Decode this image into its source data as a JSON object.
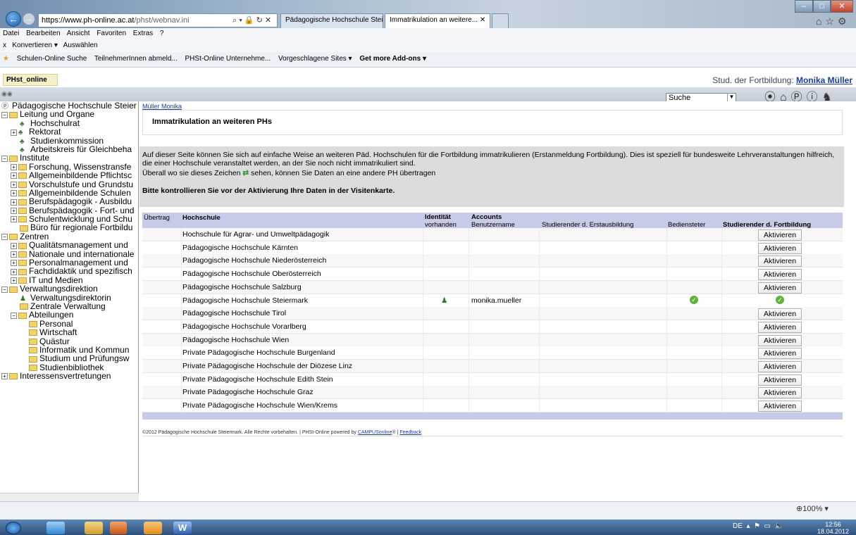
{
  "browser": {
    "address_host": "https://www.ph-online.ac.at",
    "address_path": "/phst/webnav.ini",
    "address_controls": "⌕ ▾ 🔒 ↻ ✕",
    "tab1": "Pädagogische Hochschule Stei...",
    "tab2": "Immatrikulation an weitere...",
    "menu": [
      "Datei",
      "Bearbeiten",
      "Ansicht",
      "Favoriten",
      "Extras",
      "?"
    ],
    "cmd_close": "x",
    "cmd_convert": "Konvertieren",
    "cmd_select": "Auswählen",
    "favorites": [
      "Schulen-Online Suche",
      "TeilnehmerInnen abmeld...",
      "PHSt-Online Unternehme...",
      "Vorgeschlagene Sites ▾",
      "Get more Add-ons ▾"
    ],
    "zoom": "100%"
  },
  "app": {
    "tab_label": "PHst_online",
    "user_prefix": "Stud. der Fortbildung:",
    "user_name": "Monika Müller",
    "search_value": "Suche"
  },
  "sidebar": {
    "items": [
      {
        "label": "Pädagogische Hochschule Steier",
        "indent": 0,
        "kind": "root"
      },
      {
        "label": "Leitung und Organe",
        "indent": 0,
        "kind": "folder",
        "exp": "−"
      },
      {
        "label": "Hochschulrat",
        "indent": 2,
        "kind": "people"
      },
      {
        "label": "Rektorat",
        "indent": 1,
        "kind": "people",
        "exp": "+"
      },
      {
        "label": "Studienkommission",
        "indent": 2,
        "kind": "people"
      },
      {
        "label": "Arbeitskreis für Gleichbeha",
        "indent": 2,
        "kind": "people"
      },
      {
        "label": "Institute",
        "indent": 0,
        "kind": "folder",
        "exp": "−"
      },
      {
        "label": "Forschung, Wissenstransfe",
        "indent": 1,
        "kind": "folder",
        "exp": "+"
      },
      {
        "label": "Allgemeinbildende Pflichtsc",
        "indent": 1,
        "kind": "folder",
        "exp": "+"
      },
      {
        "label": "Vorschulstufe und Grundstu",
        "indent": 1,
        "kind": "folder",
        "exp": "+"
      },
      {
        "label": "Allgemeinbildende Schulen",
        "indent": 1,
        "kind": "folder",
        "exp": "+"
      },
      {
        "label": "Berufspädagogik - Ausbildu",
        "indent": 1,
        "kind": "folder",
        "exp": "+"
      },
      {
        "label": "Berufspädagogik - Fort- und",
        "indent": 1,
        "kind": "folder",
        "exp": "+"
      },
      {
        "label": "Schulentwicklung und Schu",
        "indent": 1,
        "kind": "folder",
        "exp": "+"
      },
      {
        "label": "Büro für regionale Fortbildu",
        "indent": 2,
        "kind": "folder"
      },
      {
        "label": "Zentren",
        "indent": 0,
        "kind": "folder",
        "exp": "−"
      },
      {
        "label": "Qualitätsmanagement und",
        "indent": 1,
        "kind": "folder",
        "exp": "+"
      },
      {
        "label": "Nationale und internationale",
        "indent": 1,
        "kind": "folder",
        "exp": "+"
      },
      {
        "label": "Personalmanagement und",
        "indent": 1,
        "kind": "folder",
        "exp": "+"
      },
      {
        "label": "Fachdidaktik und spezifisch",
        "indent": 1,
        "kind": "folder",
        "exp": "+"
      },
      {
        "label": "IT und Medien",
        "indent": 1,
        "kind": "folder",
        "exp": "+"
      },
      {
        "label": "Verwaltungsdirektion",
        "indent": 0,
        "kind": "folder",
        "exp": "−"
      },
      {
        "label": "Verwaltungsdirektorin",
        "indent": 2,
        "kind": "person"
      },
      {
        "label": "Zentrale Verwaltung",
        "indent": 2,
        "kind": "folder"
      },
      {
        "label": "Abteilungen",
        "indent": 1,
        "kind": "folder",
        "exp": "−"
      },
      {
        "label": "Personal",
        "indent": 3,
        "kind": "folder"
      },
      {
        "label": "Wirtschaft",
        "indent": 3,
        "kind": "folder"
      },
      {
        "label": "Quästur",
        "indent": 3,
        "kind": "folder"
      },
      {
        "label": "Informatik und Kommun",
        "indent": 3,
        "kind": "folder"
      },
      {
        "label": "Studium und Prüfungsw",
        "indent": 3,
        "kind": "folder"
      },
      {
        "label": "Studienbibliothek",
        "indent": 3,
        "kind": "folder"
      },
      {
        "label": "Interessensvertretungen",
        "indent": 0,
        "kind": "folder",
        "exp": "+"
      }
    ]
  },
  "main": {
    "breadcrumb": "Müller Monika",
    "page_title": "Immatrikulation an weiteren PHs",
    "info1": "Auf dieser Seite können Sie sich auf einfache Weise an weiteren Päd. Hochschulen für die Fortbildung immatrikulieren (Erstanmeldung Fortbildung). Dies ist speziell für bundesweite Lehrveranstaltungen hilfreich, die einer Hochschule veranstaltet werden, an der Sie noch nicht immatrikuliert sind.",
    "info2a": "Überall wo sie dieses Zeichen",
    "info2b": "sehen, können Sie Daten an eine andere PH übertragen",
    "info3": "Bitte kontrollieren Sie vor der Aktivierung Ihre Daten in der Visitenkarte."
  },
  "table": {
    "headers": {
      "uebertrag": "Übertrag",
      "hochschule": "Hochschule",
      "identitaet": "Identität",
      "accounts": "Accounts",
      "vorhanden": "vorhanden",
      "benutzername": "Benutzername",
      "erstausbildung": "Studierender d. Erstausbildung",
      "bediensteter": "Bediensteter",
      "fortbildung": "Studierender d. Fortbildung"
    },
    "button_label": "Aktivieren",
    "rows": [
      {
        "name": "Hochschule für Agrar- und Umweltpädagogik",
        "username": "",
        "identity": false,
        "bediensteter": false,
        "fortbildung": false
      },
      {
        "name": "Pädagogische Hochschule Kärnten",
        "username": "",
        "identity": false,
        "bediensteter": false,
        "fortbildung": false
      },
      {
        "name": "Pädagogische Hochschule Niederösterreich",
        "username": "",
        "identity": false,
        "bediensteter": false,
        "fortbildung": false
      },
      {
        "name": "Pädagogische Hochschule Oberösterreich",
        "username": "",
        "identity": false,
        "bediensteter": false,
        "fortbildung": false
      },
      {
        "name": "Pädagogische Hochschule Salzburg",
        "username": "",
        "identity": false,
        "bediensteter": false,
        "fortbildung": false
      },
      {
        "name": "Pädagogische Hochschule Steiermark",
        "username": "monika.mueller",
        "identity": true,
        "bediensteter": true,
        "fortbildung": true
      },
      {
        "name": "Pädagogische Hochschule Tirol",
        "username": "",
        "identity": false,
        "bediensteter": false,
        "fortbildung": false
      },
      {
        "name": "Pädagogische Hochschule Vorarlberg",
        "username": "",
        "identity": false,
        "bediensteter": false,
        "fortbildung": false
      },
      {
        "name": "Pädagogische Hochschule Wien",
        "username": "",
        "identity": false,
        "bediensteter": false,
        "fortbildung": false
      },
      {
        "name": "Private Pädagogische Hochschule Burgenland",
        "username": "",
        "identity": false,
        "bediensteter": false,
        "fortbildung": false
      },
      {
        "name": "Private Pädagogische Hochschule der Diözese Linz",
        "username": "",
        "identity": false,
        "bediensteter": false,
        "fortbildung": false
      },
      {
        "name": "Private Pädagogische Hochschule Edith Stein",
        "username": "",
        "identity": false,
        "bediensteter": false,
        "fortbildung": false
      },
      {
        "name": "Private Pädagogische Hochschule Graz",
        "username": "",
        "identity": false,
        "bediensteter": false,
        "fortbildung": false
      },
      {
        "name": "Private Pädagogische Hochschule Wien/Krems",
        "username": "",
        "identity": false,
        "bediensteter": false,
        "fortbildung": false
      }
    ]
  },
  "footer": {
    "copyright": "©2012 Pädagogische Hochschule Steiermark. Alle Rechte vorbehalten. | PHSt-Online powered by",
    "campus": "CAMPUSonline",
    "reg": "® |",
    "feedback": "Feedback"
  },
  "taskbar": {
    "lang": "DE",
    "time": "12:56",
    "date": "18.04.2012"
  }
}
